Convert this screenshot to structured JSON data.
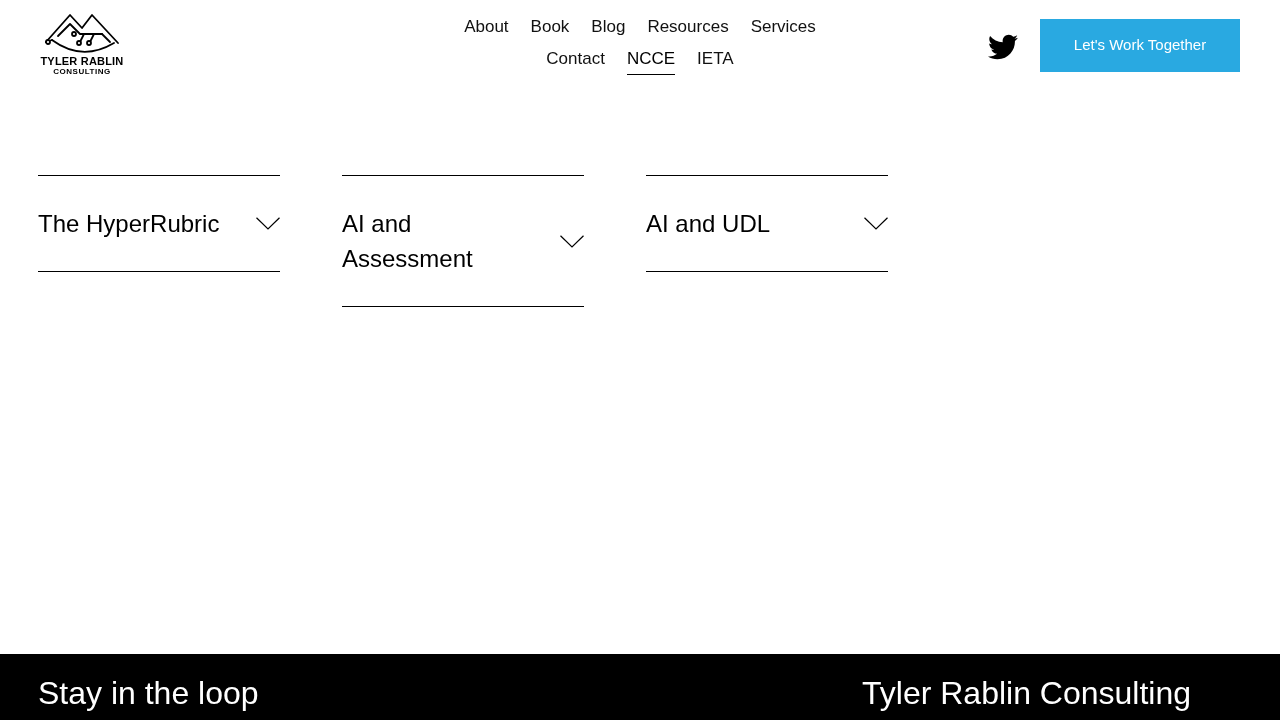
{
  "header": {
    "logo": {
      "name": "TYLER RABLIN",
      "tagline": "CONSULTING"
    },
    "nav_rows": [
      {
        "items": [
          {
            "label": "About",
            "selected": false
          },
          {
            "label": "Book",
            "selected": false
          },
          {
            "label": "Blog",
            "selected": false
          },
          {
            "label": "Resources",
            "selected": false
          },
          {
            "label": "Services",
            "selected": false
          }
        ]
      },
      {
        "items": [
          {
            "label": "Contact",
            "selected": false
          },
          {
            "label": "NCCE",
            "selected": true
          },
          {
            "label": "IETA",
            "selected": false
          }
        ]
      }
    ],
    "cta_button": "Let's Work Together"
  },
  "accordions": [
    {
      "title": "The HyperRubric",
      "expanded": false
    },
    {
      "title": "AI and Assessment",
      "expanded": false
    },
    {
      "title": "AI and UDL",
      "expanded": false
    }
  ],
  "footer": {
    "newsletter_heading": "Stay in the loop",
    "company_heading": "Tyler Rablin Consulting"
  }
}
